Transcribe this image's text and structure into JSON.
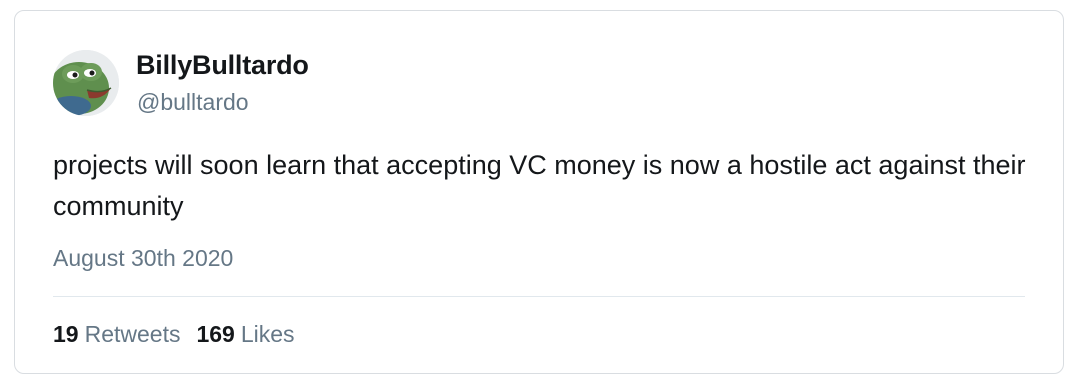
{
  "tweet": {
    "display_name": "BillyBulltardo",
    "handle": "@bulltardo",
    "avatar_icon": "frog-avatar-icon",
    "text": "projects will soon learn that accepting VC money is now a hostile act against their community",
    "date": "August 30th 2020",
    "retweets": {
      "count": "19",
      "label": "Retweets"
    },
    "likes": {
      "count": "169",
      "label": "Likes"
    }
  },
  "colors": {
    "text_primary": "#14171a",
    "text_secondary": "#657786",
    "border": "#d9dde1",
    "avatar_green": "#5f8f4e"
  }
}
